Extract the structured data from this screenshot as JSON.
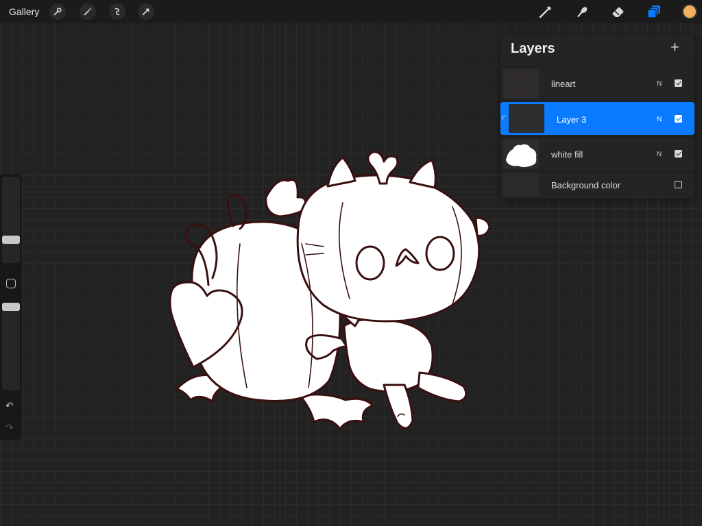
{
  "topbar": {
    "gallery_label": "Gallery",
    "left_tools": [
      "wrench-icon",
      "magic-wand-icon",
      "selection-icon",
      "transform-icon"
    ],
    "right_tools": [
      "brush-icon",
      "smudge-icon",
      "eraser-icon",
      "layers-icon"
    ],
    "active_color": "#f0b060"
  },
  "sidebar": {
    "size_level": 0.25,
    "opacity_level": 1.0
  },
  "layers": {
    "title": "Layers",
    "add_label": "+",
    "accent": "#0a7aff",
    "items": [
      {
        "name": "lineart",
        "blend": "N",
        "visible": true,
        "active": false
      },
      {
        "name": "Layer 3",
        "blend": "N",
        "visible": true,
        "active": true
      },
      {
        "name": "white fill",
        "blend": "N",
        "visible": true,
        "active": false
      },
      {
        "name": "Background color",
        "blend": "",
        "visible": false,
        "active": false
      }
    ]
  },
  "canvas": {
    "line_color": "#3a0f0f",
    "fill_color": "#ffffff"
  }
}
